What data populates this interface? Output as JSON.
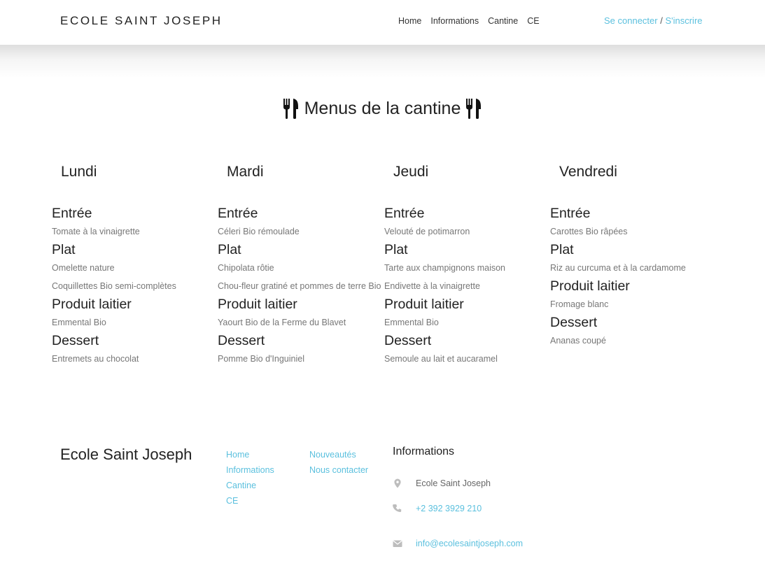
{
  "header": {
    "brand": "ECOLE SAINT JOSEPH",
    "nav": [
      "Home",
      "Informations",
      "Cantine",
      "CE"
    ],
    "login": "Se connecter",
    "separator": " / ",
    "register": "S'inscrire"
  },
  "title": "Menus de la cantine",
  "icons": {
    "title_left": "fork-knife-icon",
    "title_right": "fork-knife-icon"
  },
  "days": [
    {
      "name": "Lundi",
      "sections": [
        {
          "heading": "Entrée",
          "items": [
            "Tomate à la vinaigrette"
          ]
        },
        {
          "heading": "Plat",
          "items": [
            "Omelette nature",
            "Coquillettes Bio semi-complètes"
          ]
        },
        {
          "heading": "Produit laitier",
          "items": [
            "Emmental Bio"
          ]
        },
        {
          "heading": "Dessert",
          "items": [
            "Entremets au chocolat"
          ]
        }
      ]
    },
    {
      "name": "Mardi",
      "sections": [
        {
          "heading": "Entrée",
          "items": [
            "Céleri Bio rémoulade"
          ]
        },
        {
          "heading": "Plat",
          "items": [
            "Chipolata rôtie",
            "Chou-fleur gratiné et pommes de terre Bio"
          ]
        },
        {
          "heading": "Produit laitier",
          "items": [
            "Yaourt Bio de la Ferme du Blavet"
          ]
        },
        {
          "heading": "Dessert",
          "items": [
            "Pomme Bio d'Inguiniel"
          ]
        }
      ]
    },
    {
      "name": "Jeudi",
      "sections": [
        {
          "heading": "Entrée",
          "items": [
            "Velouté de potimarron"
          ]
        },
        {
          "heading": "Plat",
          "items": [
            "Tarte aux champignons maison",
            "Endivette à la vinaigrette"
          ]
        },
        {
          "heading": "Produit laitier",
          "items": [
            "Emmental Bio"
          ]
        },
        {
          "heading": "Dessert",
          "items": [
            "Semoule au lait et aucaramel"
          ]
        }
      ]
    },
    {
      "name": "Vendredi",
      "sections": [
        {
          "heading": "Entrée",
          "items": [
            "Carottes Bio râpées"
          ]
        },
        {
          "heading": "Plat",
          "items": [
            "Riz au curcuma et à la cardamome"
          ]
        },
        {
          "heading": "Produit laitier",
          "items": [
            "Fromage blanc"
          ]
        },
        {
          "heading": "Dessert",
          "items": [
            "Ananas coupé"
          ]
        }
      ]
    }
  ],
  "footer": {
    "brand": "Ecole Saint Joseph",
    "links_col1": [
      "Home",
      "Informations",
      "Cantine",
      "CE"
    ],
    "links_col2": [
      "Nouveautés",
      "Nous contacter"
    ],
    "info_heading": "Informations",
    "address": "Ecole Saint Joseph",
    "phone": "+2 392 3929 210",
    "email": "info@ecolesaintjoseph.com"
  },
  "colors": {
    "accent": "#5bc0de",
    "muted": "#777777",
    "text": "#222222"
  }
}
